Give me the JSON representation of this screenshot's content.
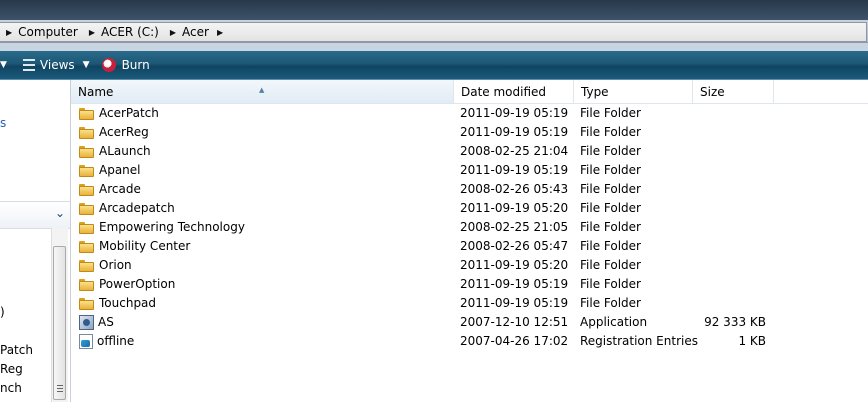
{
  "breadcrumb": [
    {
      "label": "Computer"
    },
    {
      "label": "ACER (C:)"
    },
    {
      "label": "Acer"
    }
  ],
  "toolbar": {
    "views_label": "Views",
    "burn_label": "Burn"
  },
  "nav": {
    "link_fragment": "s",
    "tree_fragments": [
      ")",
      "Patch",
      "Reg",
      "nch"
    ]
  },
  "columns": {
    "name": "Name",
    "date": "Date modified",
    "type": "Type",
    "size": "Size"
  },
  "files": [
    {
      "name": "AcerPatch",
      "date": "2011-09-19 05:19",
      "type": "File Folder",
      "size": "",
      "icon": "folder-icon"
    },
    {
      "name": "AcerReg",
      "date": "2011-09-19 05:19",
      "type": "File Folder",
      "size": "",
      "icon": "folder-icon"
    },
    {
      "name": "ALaunch",
      "date": "2008-02-25 21:04",
      "type": "File Folder",
      "size": "",
      "icon": "folder-icon"
    },
    {
      "name": "Apanel",
      "date": "2011-09-19 05:19",
      "type": "File Folder",
      "size": "",
      "icon": "folder-icon"
    },
    {
      "name": "Arcade",
      "date": "2008-02-26 05:43",
      "type": "File Folder",
      "size": "",
      "icon": "folder-icon"
    },
    {
      "name": "Arcadepatch",
      "date": "2011-09-19 05:20",
      "type": "File Folder",
      "size": "",
      "icon": "folder-icon"
    },
    {
      "name": "Empowering Technology",
      "date": "2008-02-25 21:05",
      "type": "File Folder",
      "size": "",
      "icon": "folder-icon"
    },
    {
      "name": "Mobility Center",
      "date": "2008-02-26 05:47",
      "type": "File Folder",
      "size": "",
      "icon": "folder-icon"
    },
    {
      "name": "Orion",
      "date": "2011-09-19 05:20",
      "type": "File Folder",
      "size": "",
      "icon": "folder-icon"
    },
    {
      "name": "PowerOption",
      "date": "2011-09-19 05:19",
      "type": "File Folder",
      "size": "",
      "icon": "folder-icon"
    },
    {
      "name": "Touchpad",
      "date": "2011-09-19 05:19",
      "type": "File Folder",
      "size": "",
      "icon": "folder-icon"
    },
    {
      "name": "AS",
      "date": "2007-12-10 12:51",
      "type": "Application",
      "size": "92 333 KB",
      "icon": "application-icon"
    },
    {
      "name": "offline",
      "date": "2007-04-26 17:02",
      "type": "Registration Entries",
      "size": "1 KB",
      "icon": "registry-file-icon"
    }
  ],
  "colors": {
    "toolbar": "#1d5876",
    "link": "#1f5eb8",
    "titlebar": "#27384a"
  }
}
